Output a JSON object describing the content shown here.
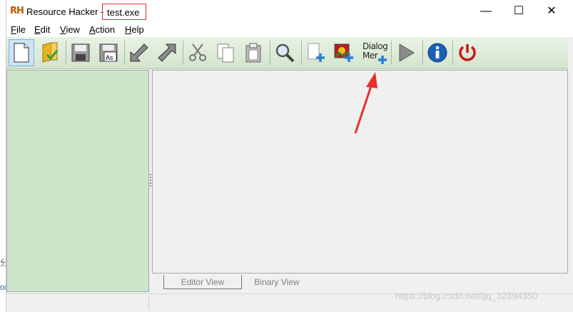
{
  "window": {
    "app_logo": "RH",
    "title": "Resource Hacker  -",
    "file_name": "test.exe",
    "minimize_glyph": "—",
    "maximize_glyph": "☐",
    "close_glyph": "✕"
  },
  "menu": {
    "items": [
      {
        "label": "File",
        "key": "F"
      },
      {
        "label": "Edit",
        "key": "E"
      },
      {
        "label": "View",
        "key": "V"
      },
      {
        "label": "Action",
        "key": "A"
      },
      {
        "label": "Help",
        "key": "H"
      }
    ]
  },
  "toolbar": {
    "icons": [
      "new-document-icon",
      "open-folder-icon",
      "save-icon",
      "save-as-icon",
      "import-icon",
      "export-icon",
      "cut-icon",
      "copy-icon",
      "paste-icon",
      "search-icon",
      "add-blank-resource-icon",
      "add-image-resource-icon",
      "add-dialog-menu-icon",
      "run-icon",
      "info-icon",
      "power-icon"
    ],
    "dialog_label_line1": "Dialog",
    "dialog_label_line2": "Mer",
    "save_as_text": "As"
  },
  "tabs": {
    "editor_view": "Editor View",
    "binary_view": "Binary View"
  },
  "watermark": "https://blog.csdn.net/qq_32394350",
  "background": {
    "char1": "分",
    "char2": "or"
  },
  "colors": {
    "left_pane": "#cce6cc",
    "toolbar": "#d3e4cc",
    "highlight_box": "#e03030",
    "arrow": "#e8302a"
  }
}
